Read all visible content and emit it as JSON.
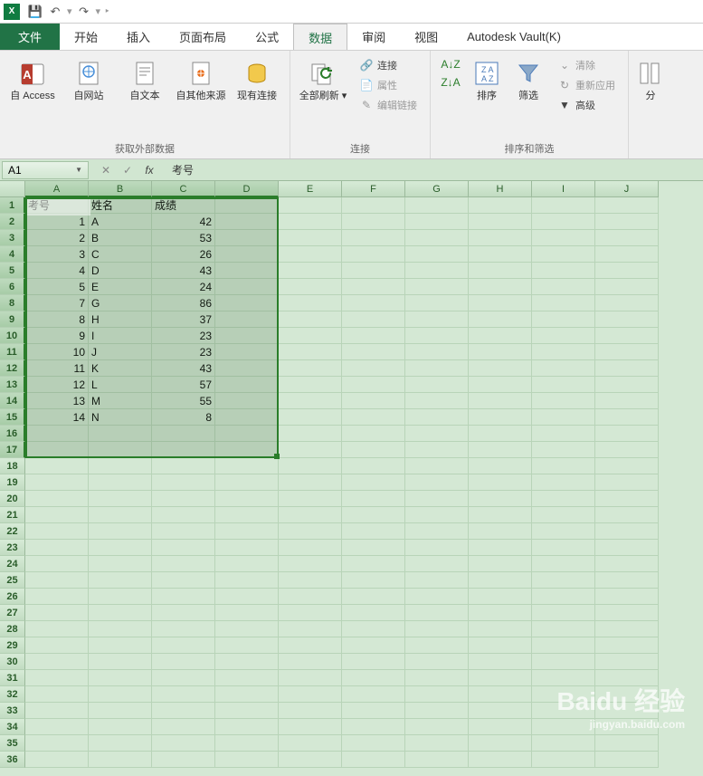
{
  "qat": {
    "save": "💾",
    "undo": "↶",
    "redo": "↷"
  },
  "tabs": {
    "file": "文件",
    "items": [
      "开始",
      "插入",
      "页面布局",
      "公式",
      "数据",
      "审阅",
      "视图",
      "Autodesk Vault(K)"
    ],
    "active_index": 4
  },
  "ribbon": {
    "group_external": {
      "label": "获取外部数据",
      "access": "自 Access",
      "web": "自网站",
      "text": "自文本",
      "other": "自其他来源",
      "existing": "现有连接"
    },
    "group_conn": {
      "label": "连接",
      "refresh": "全部刷新",
      "connection": "连接",
      "properties": "属性",
      "editlinks": "编辑链接"
    },
    "group_sort": {
      "label": "排序和筛选",
      "sort": "排序",
      "filter": "筛选",
      "clear": "清除",
      "reapply": "重新应用",
      "advanced": "高级"
    },
    "group_right": {
      "label": "分"
    }
  },
  "namebox": "A1",
  "formula": "考号",
  "columns": [
    "A",
    "B",
    "C",
    "D",
    "E",
    "F",
    "G",
    "H",
    "I",
    "J"
  ],
  "sel_cols": 4,
  "sel_rows": 16,
  "total_rows": 36,
  "chart_data": {
    "type": "table",
    "headers": [
      "考号",
      "姓名",
      "成绩"
    ],
    "rows": [
      [
        1,
        "A",
        42
      ],
      [
        2,
        "B",
        53
      ],
      [
        3,
        "C",
        26
      ],
      [
        4,
        "D",
        43
      ],
      [
        5,
        "E",
        24
      ],
      [
        7,
        "G",
        86
      ],
      [
        8,
        "H",
        37
      ],
      [
        9,
        "I",
        23
      ],
      [
        10,
        "J",
        23
      ],
      [
        11,
        "K",
        43
      ],
      [
        12,
        "L",
        57
      ],
      [
        13,
        "M",
        55
      ],
      [
        14,
        "N",
        8
      ]
    ],
    "visible_row_labels": [
      1,
      2,
      3,
      4,
      5,
      6,
      8,
      9,
      10,
      11,
      12,
      13,
      14,
      15,
      16,
      17,
      18,
      19,
      20,
      21,
      22,
      23,
      24,
      25,
      26,
      27,
      28,
      29,
      30,
      31,
      32,
      33,
      34,
      35,
      36
    ]
  },
  "watermark": {
    "main": "Baidu 经验",
    "sub": "jingyan.baidu.com"
  }
}
